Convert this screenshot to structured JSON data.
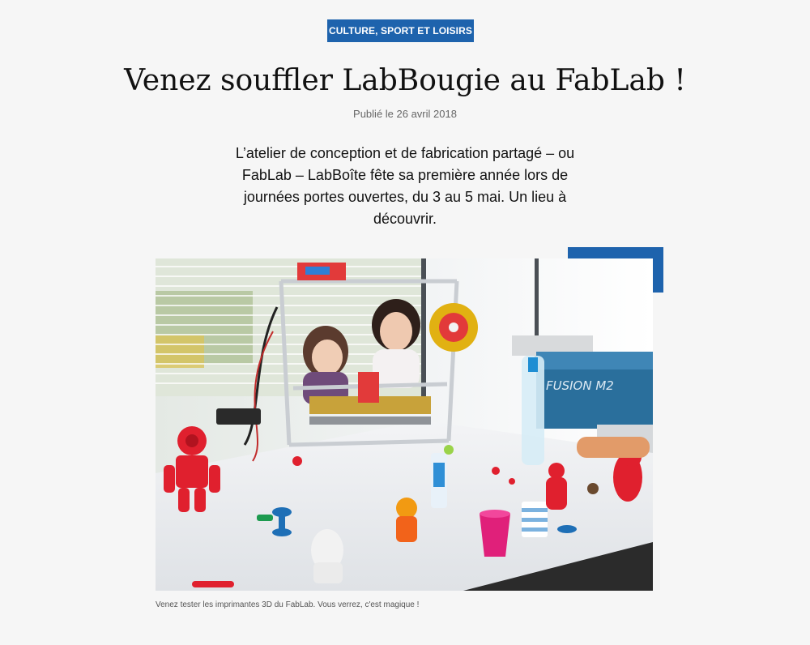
{
  "article": {
    "category": "CULTURE, SPORT ET LOISIRS",
    "title": "Venez souffler LabBougie au FabLab !",
    "published": "Publié le 26 avril 2018",
    "lead": "L’atelier de conception et de fabrication partagé – ou FabLab – LabBoîte fête sa première année lors de journées portes ouvertes, du 3 au 5 mai. Un lieu à découvrir.",
    "figure": {
      "caption": "Venez tester les imprimantes 3D du FabLab. Vous verrez, c'est magique !",
      "machine_label": "FUSION M2"
    }
  },
  "colors": {
    "accent": "#1e63ad",
    "background": "#f6f6f6"
  }
}
